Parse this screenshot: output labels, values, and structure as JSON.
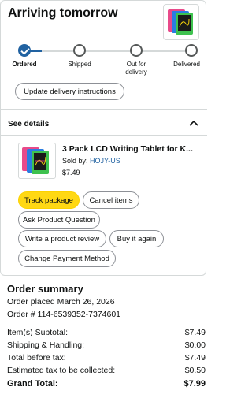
{
  "delivery": {
    "heading": "Arriving tomorrow",
    "steps": [
      "Ordered",
      "Shipped",
      "Out for delivery",
      "Delivered"
    ],
    "current_step": 1,
    "update_button": "Update delivery instructions"
  },
  "details": {
    "toggle_label": "See details"
  },
  "product": {
    "title": "3 Pack LCD Writing Tablet for K...",
    "sold_by_prefix": "Sold by: ",
    "seller": "HOJY-US",
    "price": "$7.49"
  },
  "actions": {
    "track": "Track package",
    "cancel": "Cancel items",
    "ask": "Ask Product Question",
    "review": "Write a product review",
    "buy_again": "Buy it again",
    "change_payment": "Change Payment Method"
  },
  "summary": {
    "title": "Order summary",
    "placed": "Order placed March 26, 2026",
    "order_number": "Order # 114-6539352-7374601",
    "rows": [
      {
        "label": "Item(s) Subtotal:",
        "value": "$7.49"
      },
      {
        "label": "Shipping & Handling:",
        "value": "$0.00"
      },
      {
        "label": "Total before tax:",
        "value": "$7.49"
      },
      {
        "label": "Estimated tax to be collected:",
        "value": "$0.50"
      }
    ],
    "grand_label": "Grand Total:",
    "grand_value": "$7.99"
  },
  "colors": {
    "progress": "#2162a1",
    "link": "#2162a1",
    "primary_button": "#ffd814"
  }
}
